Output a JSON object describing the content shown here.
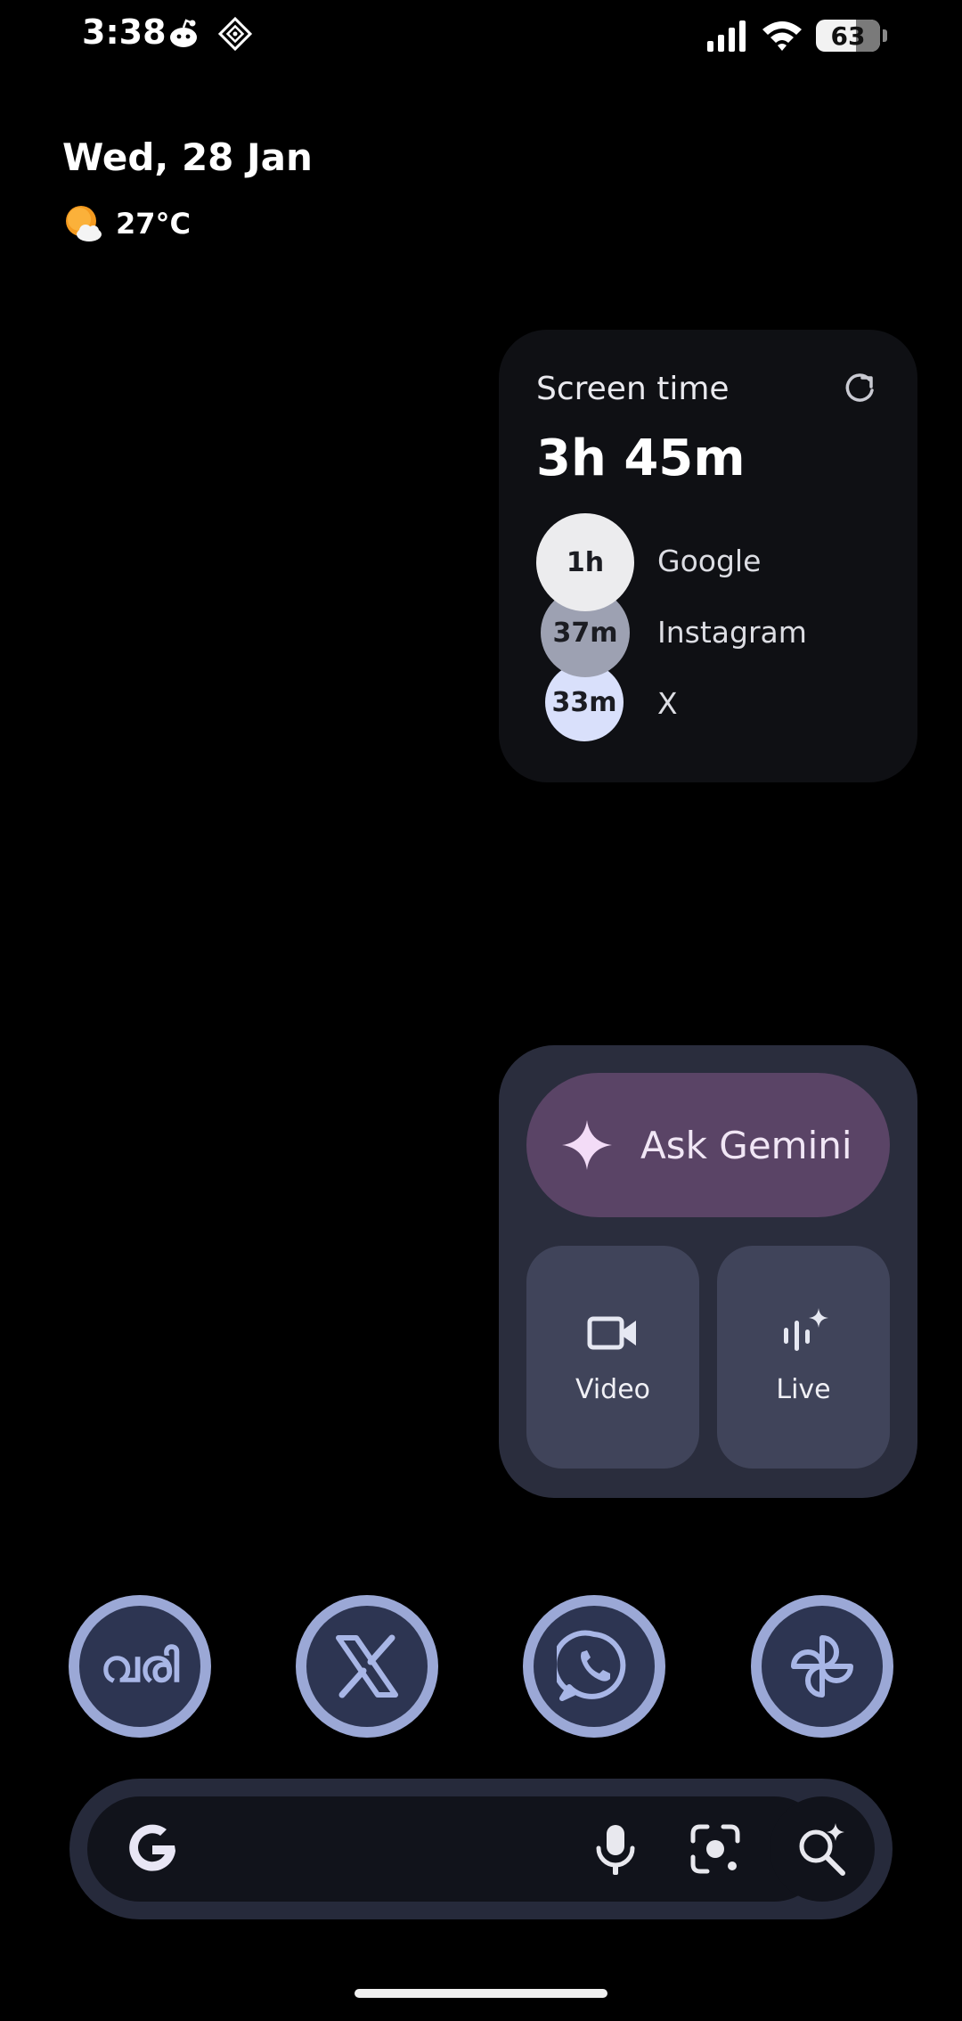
{
  "status_bar": {
    "time": "3:38",
    "notification_icons": [
      "reddit-icon",
      "signal-app-icon"
    ],
    "battery_percent": "63",
    "icons": [
      "cellular-signal-icon",
      "wifi-icon",
      "battery-icon"
    ]
  },
  "at_a_glance": {
    "date": "Wed, 28 Jan",
    "weather_icon": "partly-cloudy-icon",
    "temperature": "27°C"
  },
  "screen_time": {
    "title": "Screen time",
    "total": "3h 45m",
    "apps": [
      {
        "duration": "1h",
        "name": "Google"
      },
      {
        "duration": "37m",
        "name": "Instagram"
      },
      {
        "duration": "33m",
        "name": "X"
      }
    ]
  },
  "gemini": {
    "ask_label": "Ask Gemini",
    "video_label": "Video",
    "live_label": "Live"
  },
  "dock": {
    "apps": [
      "varikal-app-icon",
      "x-app-icon",
      "whatsapp-app-icon",
      "pinwheel-app-icon"
    ],
    "varikal_glyph": "വരി"
  },
  "search_bar": {
    "icons": [
      "google-g-icon",
      "microphone-icon",
      "google-lens-icon",
      "ai-search-icon"
    ]
  },
  "colors": {
    "background": "#000000",
    "widget_dark": "#0f1014",
    "gemini_bg": "#2a2d3d",
    "ask_gemini": "#5a4466",
    "dock_ring": "#9ba8d6"
  }
}
